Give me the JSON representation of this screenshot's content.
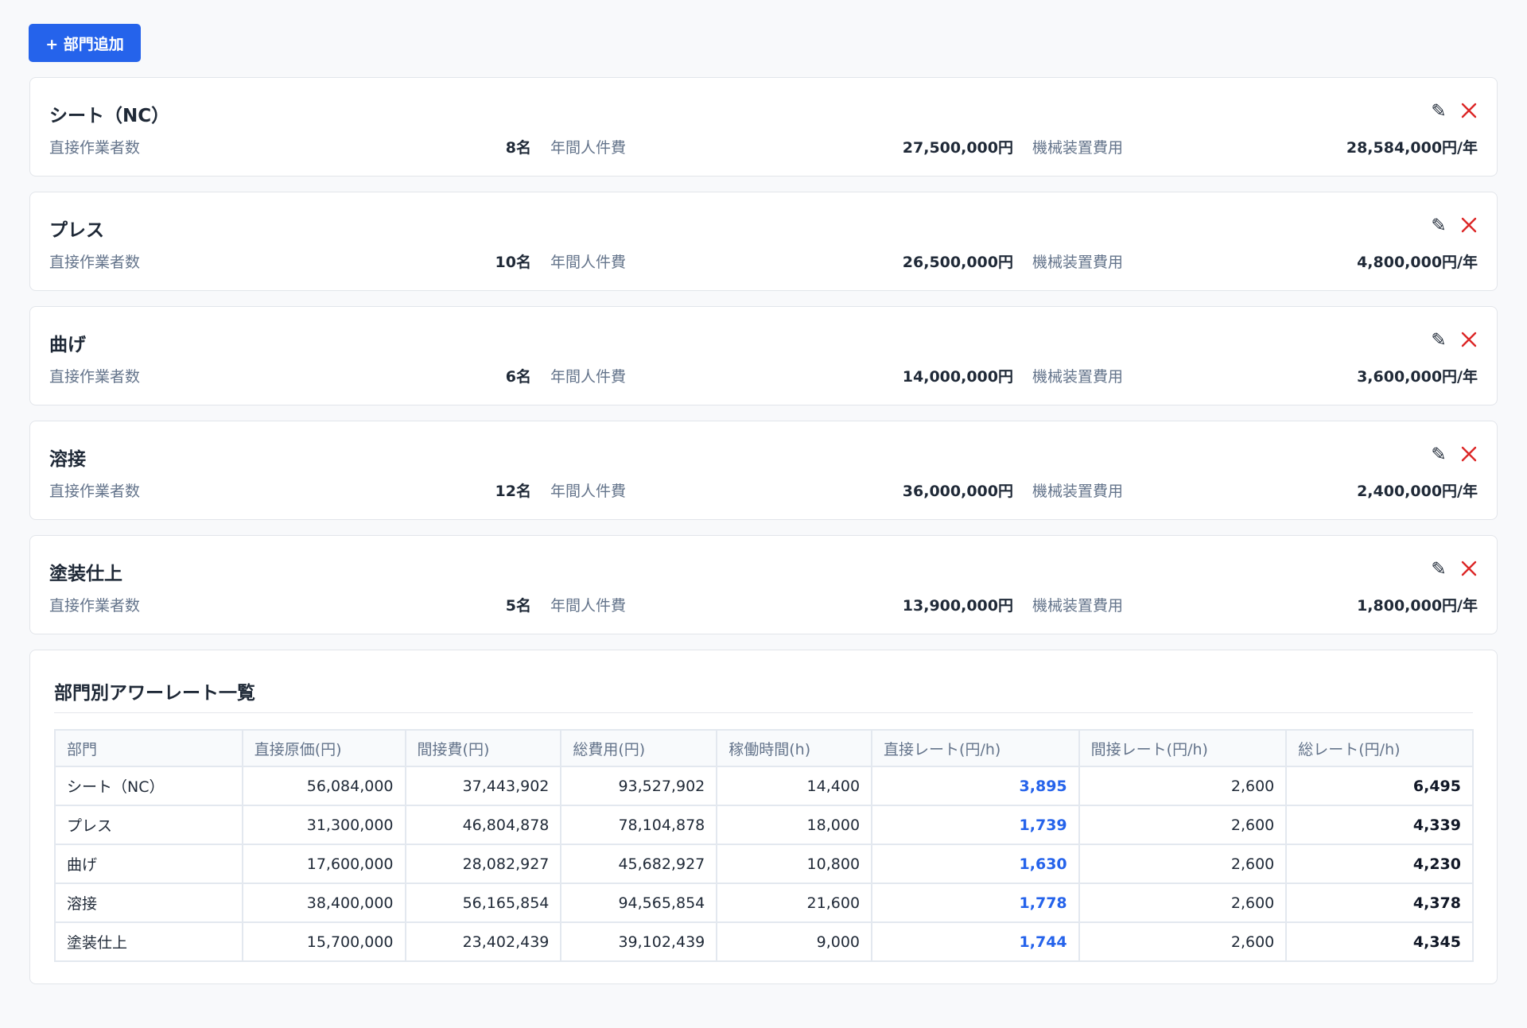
{
  "toolbar": {
    "add_label": "+ 部門追加"
  },
  "departments": [
    {
      "name": "シート（NC）",
      "workers_label": "直接作業者数",
      "workers": "8名",
      "labor_label": "年間人件費",
      "labor": "27,500,000円",
      "machine_label": "機械装置費用",
      "machine": "28,584,000円/年"
    },
    {
      "name": "プレス",
      "workers_label": "直接作業者数",
      "workers": "10名",
      "labor_label": "年間人件費",
      "labor": "26,500,000円",
      "machine_label": "機械装置費用",
      "machine": "4,800,000円/年"
    },
    {
      "name": "曲げ",
      "workers_label": "直接作業者数",
      "workers": "6名",
      "labor_label": "年間人件費",
      "labor": "14,000,000円",
      "machine_label": "機械装置費用",
      "machine": "3,600,000円/年"
    },
    {
      "name": "溶接",
      "workers_label": "直接作業者数",
      "workers": "12名",
      "labor_label": "年間人件費",
      "labor": "36,000,000円",
      "machine_label": "機械装置費用",
      "machine": "2,400,000円/年"
    },
    {
      "name": "塗装仕上",
      "workers_label": "直接作業者数",
      "workers": "5名",
      "labor_label": "年間人件費",
      "labor": "13,900,000円",
      "machine_label": "機械装置費用",
      "machine": "1,800,000円/年"
    }
  ],
  "icons": {
    "edit": "pencil-icon",
    "delete": "close-icon"
  },
  "colors": {
    "accent": "#2563eb",
    "delete": "#dc2626",
    "label": "#64748b"
  },
  "summary": {
    "title": "部門別アワーレート一覧",
    "headers": [
      "部門",
      "直接原価(円)",
      "間接費(円)",
      "総費用(円)",
      "稼働時間(h)",
      "直接レート(円/h)",
      "間接レート(円/h)",
      "総レート(円/h)"
    ],
    "rows": [
      [
        "シート（NC）",
        "56,084,000",
        "37,443,902",
        "93,527,902",
        "14,400",
        "3,895",
        "2,600",
        "6,495"
      ],
      [
        "プレス",
        "31,300,000",
        "46,804,878",
        "78,104,878",
        "18,000",
        "1,739",
        "2,600",
        "4,339"
      ],
      [
        "曲げ",
        "17,600,000",
        "28,082,927",
        "45,682,927",
        "10,800",
        "1,630",
        "2,600",
        "4,230"
      ],
      [
        "溶接",
        "38,400,000",
        "56,165,854",
        "94,565,854",
        "21,600",
        "1,778",
        "2,600",
        "4,378"
      ],
      [
        "塗装仕上",
        "15,700,000",
        "23,402,439",
        "39,102,439",
        "9,000",
        "1,744",
        "2,600",
        "4,345"
      ]
    ]
  }
}
